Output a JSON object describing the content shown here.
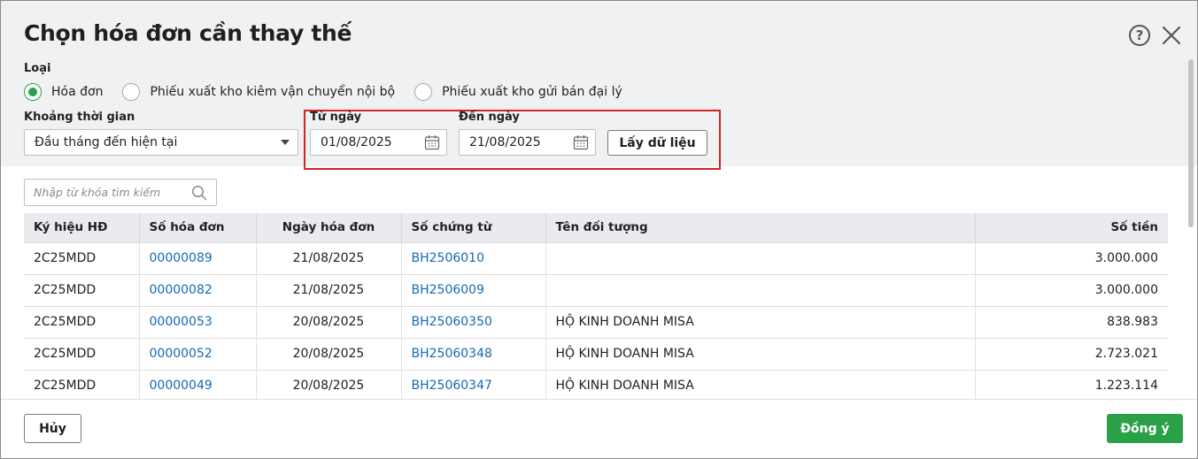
{
  "dialog": {
    "title": "Chọn hóa đơn cần thay thế",
    "help_icon": "question-circle-icon",
    "close_icon": "close-x-icon"
  },
  "filters": {
    "type_label": "Loại",
    "radios": [
      {
        "label": "Hóa đơn",
        "checked": true
      },
      {
        "label": "Phiếu xuất kho kiêm vận chuyển nội bộ",
        "checked": false
      },
      {
        "label": "Phiếu xuất kho gửi bán đại lý",
        "checked": false
      }
    ],
    "period_label": "Khoảng thời gian",
    "period_value": "Đầu tháng đến hiện tại",
    "from_label": "Từ ngày",
    "from_value": "01/08/2025",
    "to_label": "Đến ngày",
    "to_value": "21/08/2025",
    "fetch_button": "Lấy dữ liệu"
  },
  "search": {
    "placeholder": "Nhập từ khóa tìm kiếm"
  },
  "table": {
    "columns": [
      "Ký hiệu HĐ",
      "Số hóa đơn",
      "Ngày hóa đơn",
      "Số chứng từ",
      "Tên đối tượng",
      "Số tiền"
    ],
    "rows": [
      {
        "symbol": "2C25MDD",
        "invoice_no": "00000089",
        "date": "21/08/2025",
        "voucher": "BH2506010",
        "name": "",
        "amount": "3.000.000"
      },
      {
        "symbol": "2C25MDD",
        "invoice_no": "00000082",
        "date": "21/08/2025",
        "voucher": "BH2506009",
        "name": "",
        "amount": "3.000.000"
      },
      {
        "symbol": "2C25MDD",
        "invoice_no": "00000053",
        "date": "20/08/2025",
        "voucher": "BH25060350",
        "name": "HỘ KINH DOANH MISA",
        "amount": "838.983"
      },
      {
        "symbol": "2C25MDD",
        "invoice_no": "00000052",
        "date": "20/08/2025",
        "voucher": "BH25060348",
        "name": "HỘ KINH DOANH MISA",
        "amount": "2.723.021"
      },
      {
        "symbol": "2C25MDD",
        "invoice_no": "00000049",
        "date": "20/08/2025",
        "voucher": "BH25060347",
        "name": "HỘ KINH DOANH MISA",
        "amount": "1.223.114"
      }
    ]
  },
  "footer": {
    "cancel_button": "Hủy",
    "ok_button": "Đồng ý"
  },
  "colors": {
    "accent_green": "#2aa146",
    "link_blue": "#1769b3",
    "highlight_red": "#d32323"
  }
}
